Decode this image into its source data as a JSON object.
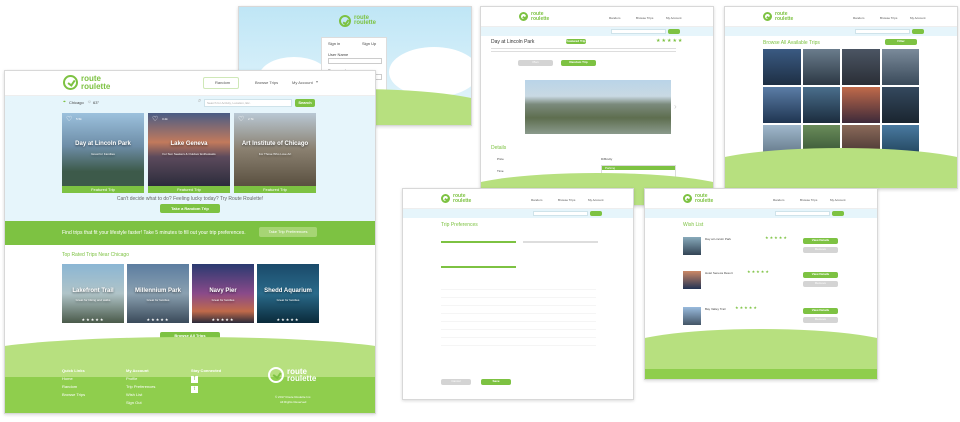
{
  "brand": {
    "line1": "route",
    "line2": "roulette",
    "green": "#7dc242",
    "light_blue": "#e6f5fb"
  },
  "main": {
    "nav": {
      "random": "Random",
      "browse": "Browse Trips",
      "account": "My Account"
    },
    "location": "Chicago",
    "temp": "63°",
    "search_placeholder": "Search for Activity, Location, Etc.",
    "search_btn": "Search",
    "featured": [
      {
        "title": "Day at Lincoln Park",
        "sub": "Great for Families",
        "likes": "5.5k",
        "bar": "Featured Trip"
      },
      {
        "title": "Lake Geneva",
        "sub": "For Sun Seekers & Outdoor Enthusiasts",
        "likes": "3.2k",
        "bar": "Featured Trip"
      },
      {
        "title": "Art Institute of Chicago",
        "sub": "For Those Who Love Art",
        "likes": "2.7k",
        "bar": "Featured Trip"
      }
    ],
    "lucky_text": "Can't decide what to do? Feeling lucky today? Try Route Roulette!",
    "random_trip_btn": "Take a Random Trip",
    "prefs_text": "Find trips that fit your lifestyle faster! Take 5 minutes to fill out your trip preferences.",
    "prefs_btn": "Take Trip Preferences",
    "top_rated_heading": "Top Rated Trips Near Chicago",
    "top_rated": [
      {
        "title": "Lakefront Trail",
        "sub": "Great for biking and walks"
      },
      {
        "title": "Millennium Park",
        "sub": "Great for families"
      },
      {
        "title": "Navy Pier",
        "sub": "Great for families"
      },
      {
        "title": "Shedd Aquarium",
        "sub": "Great for families"
      }
    ],
    "rating": "★★★★★",
    "browse_all_btn": "Browse All Trips",
    "footer": {
      "quick_links": {
        "h": "Quick Links",
        "items": [
          "Home",
          "Random",
          "Browse Trips"
        ]
      },
      "my_account": {
        "h": "My Account",
        "items": [
          "Profile",
          "Trip Preferences",
          "Wish List",
          "Sign Out"
        ]
      },
      "stay": {
        "h": "Stay Connected"
      },
      "copyright": "© 2017 Route Roulette Inc.",
      "rights": "All Rights Reserved"
    }
  },
  "signin": {
    "tab_in": "Sign in",
    "tab_up": "Sign Up",
    "user_label": "User Name",
    "pass_label": "Password"
  },
  "detail": {
    "title": "Day at Lincoln Park",
    "badge": "Featured Trip",
    "plan_btn": "Plan",
    "random_btn": "Random Trip",
    "details_heading": "Details",
    "price_label": "Price",
    "time_label": "Time",
    "difficulty_label": "Difficulty",
    "parking_label": "Parking"
  },
  "browse": {
    "heading": "Browse All Available Trips",
    "filter_btn": "Filter"
  },
  "prefs": {
    "heading": "Trip Preferences",
    "cancel": "Cancel",
    "save": "Save"
  },
  "wishlist": {
    "heading": "Wish List",
    "items": [
      "Day at Lincoln Park",
      "Hotel Seneca Resort",
      "Bay Valley Trail"
    ],
    "view_btn": "View Details",
    "remove_btn": "Remove"
  }
}
